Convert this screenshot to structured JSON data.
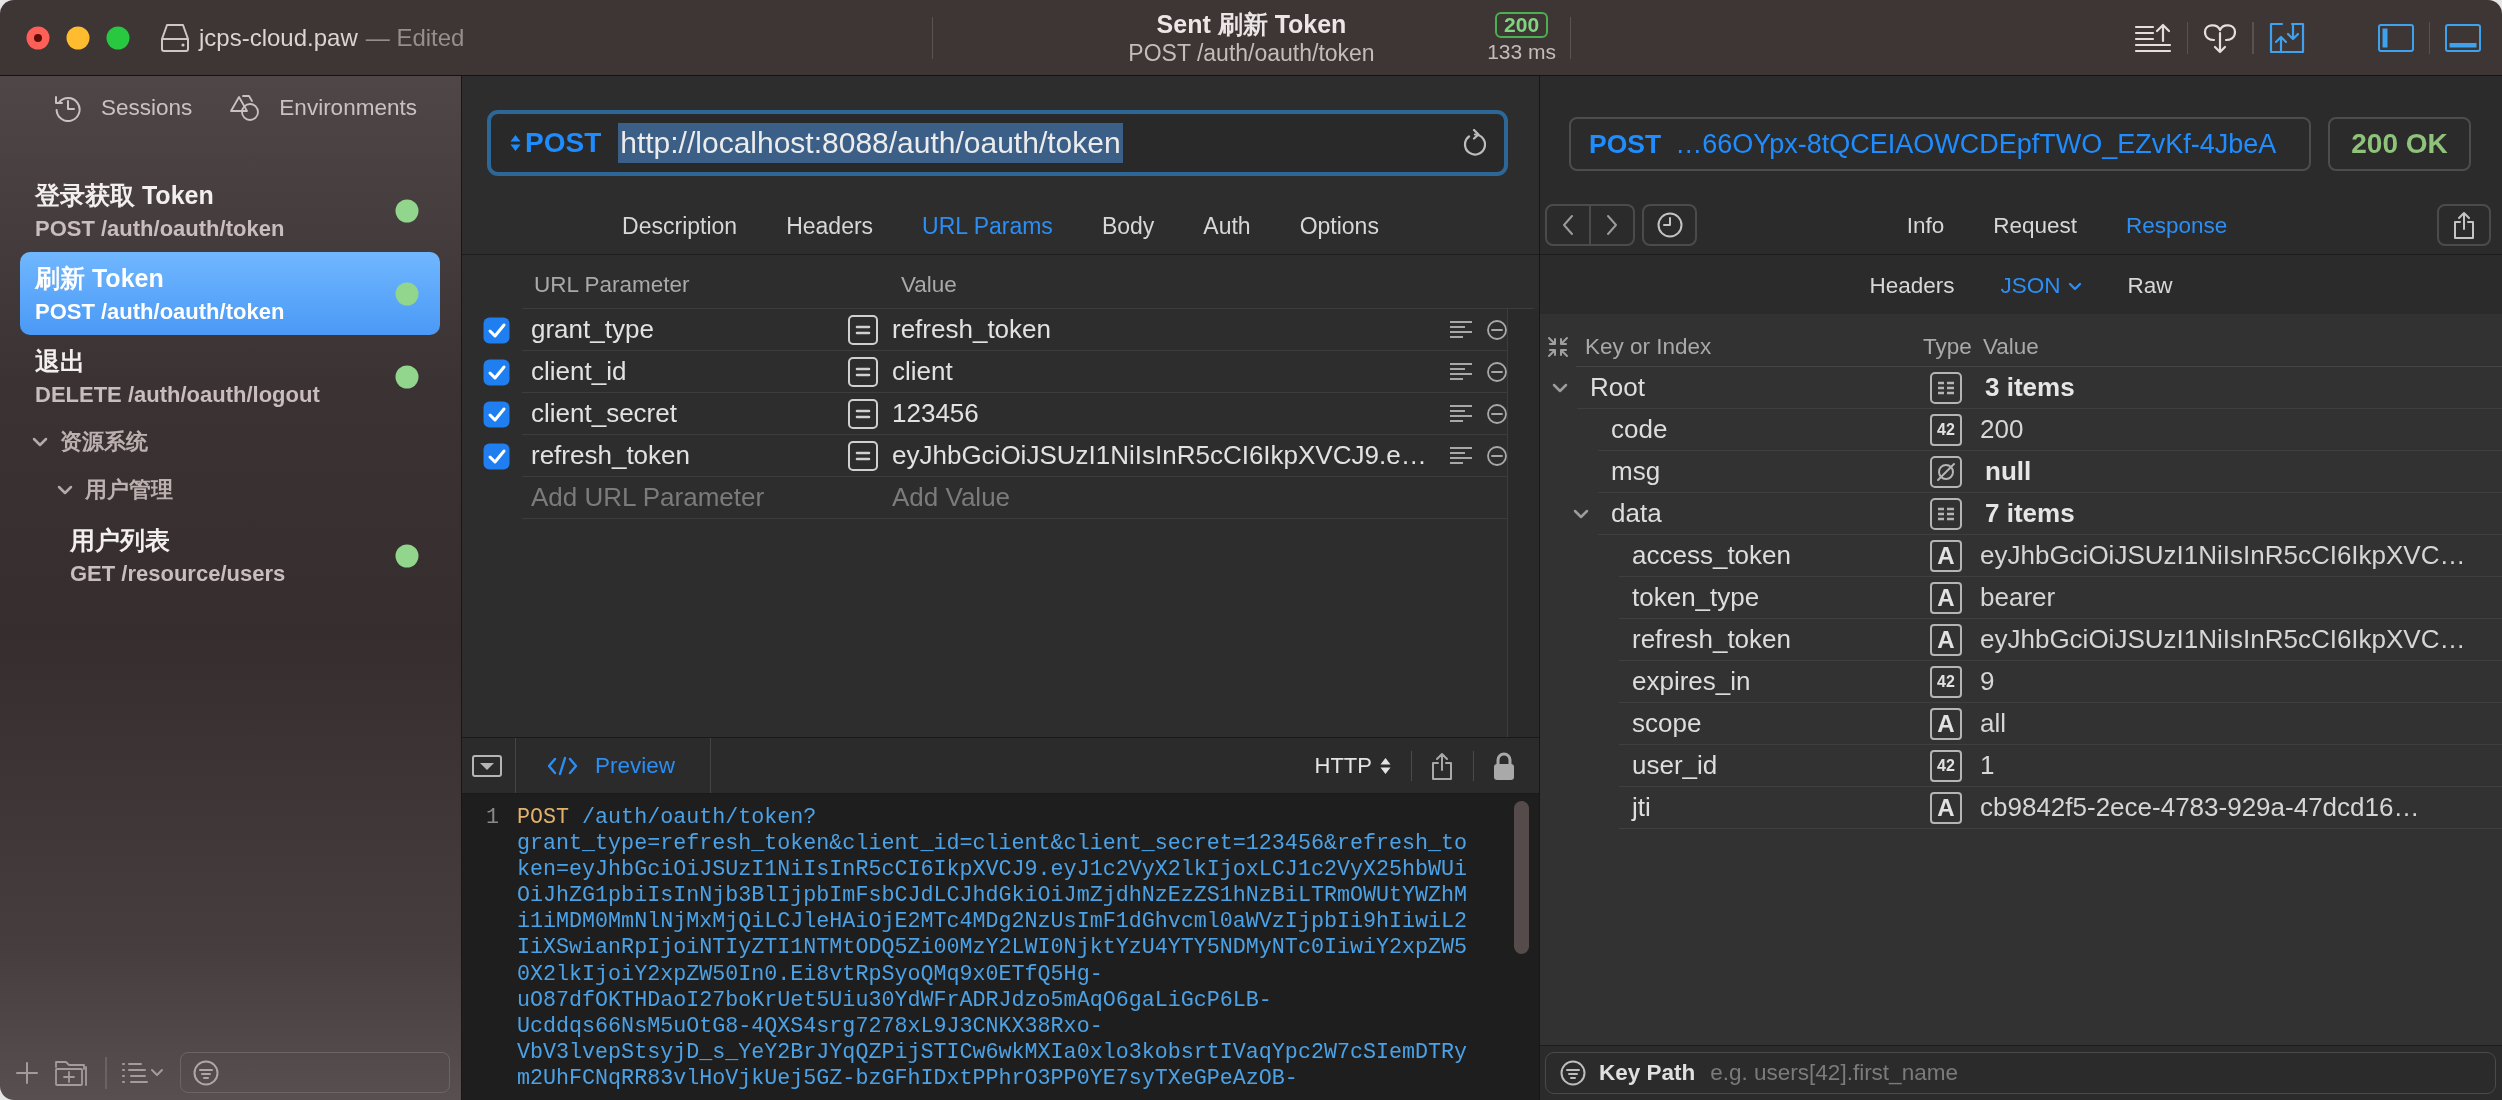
{
  "window": {
    "title": "jcps-cloud.paw",
    "edited_label": "— Edited"
  },
  "toolbar_status": {
    "title": "Sent 刷新 Token",
    "subtitle": "POST /auth/oauth/token",
    "status_code": "200",
    "duration": "133 ms"
  },
  "sidebar": {
    "tabs": [
      {
        "label": "Sessions",
        "kind": "sessions"
      },
      {
        "label": "Environments",
        "kind": "environments"
      }
    ],
    "items": [
      {
        "kind": "request",
        "title": "登录获取 Token",
        "subtitle": "POST /auth/oauth/token",
        "selected": false
      },
      {
        "kind": "request",
        "title": "刷新 Token",
        "subtitle": "POST /auth/oauth/token",
        "selected": true
      },
      {
        "kind": "request",
        "title": "退出",
        "subtitle": "DELETE /auth/oauth/logout",
        "selected": false
      },
      {
        "kind": "group",
        "title": "资源系统",
        "expanded": true,
        "children": [
          {
            "kind": "group",
            "title": "用户管理",
            "expanded": true,
            "children": [
              {
                "kind": "request",
                "title": "用户列表",
                "subtitle": "GET /resource/users",
                "selected": false
              }
            ]
          }
        ]
      }
    ]
  },
  "request": {
    "method": "POST",
    "url": "http://localhost:8088/auth/oauth/token",
    "url_text_selected": true,
    "tabs": [
      {
        "label": "Description",
        "selected": false
      },
      {
        "label": "Headers",
        "selected": false
      },
      {
        "label": "URL Params",
        "selected": true
      },
      {
        "label": "Body",
        "selected": false
      },
      {
        "label": "Auth",
        "selected": false
      },
      {
        "label": "Options",
        "selected": false
      }
    ],
    "params": {
      "columns": [
        "URL Parameter",
        "Value"
      ],
      "rows": [
        {
          "name": "grant_type",
          "value": "refresh_token",
          "enabled": true
        },
        {
          "name": "client_id",
          "value": "client",
          "enabled": true
        },
        {
          "name": "client_secret",
          "value": "123456",
          "enabled": true
        },
        {
          "name": "refresh_token",
          "value": "eyJhbGciOiJSUzI1NiIsInR5cCI6IkpXVCJ9.e…",
          "enabled": true
        }
      ],
      "new_row": {
        "name_placeholder": "Add URL Parameter",
        "value_placeholder": "Add Value"
      }
    }
  },
  "preview": {
    "tab": "Preview",
    "format": "HTTP",
    "line_number": "1",
    "method": "POST",
    "lines": [
      "/auth/oauth/token?",
      "grant_type=refresh_token&client_id=client&client_secret=123456&refresh_to",
      "ken=eyJhbGciOiJSUzI1NiIsInR5cCI6IkpXVCJ9.eyJ1c2VyX2lkIjoxLCJ1c2VyX25hbWUi",
      "OiJhZG1pbiIsInNjb3BlIjpbImFsbCJdLCJhdGkiOiJmZjdhNzEzZS1hNzBiLTRmOWUtYWZhM",
      "i1iMDM0MmNlNjMxMjQiLCJleHAiOjE2MTc4MDg2NzUsImF1dGhvcml0aWVzIjpbIi9hIiwiL2",
      "IiXSwianRpIjoiNTIyZTI1NTMtODQ5Zi00MzY2LWI0NjktYzU4YTY5NDMyNTc0IiwiY2xpZW5",
      "0X2lkIjoiY2xpZW50In0.Ei8vtRpSyoQMq9x0ETfQ5Hg-",
      "uO87dfOKTHDaoI27boKrUet5Uiu30YdWFrADRJdzo5mAqO6gaLiGcP6LB-",
      "Ucddqs66NsM5uOtG8-4QXS4srg7278xL9J3CNKX38Rxo-",
      "VbV3lvepStsyjD_s_YeY2BrJYqQZPijSTICw6wkMXIa0xlo3kobsrtIVaqYpc2W7cSIemDTRy",
      "m2UhFCNqRR83vlHoVjkUej5GZ-bzGFhIDxtPPhrO3PP0YE7syTXeGPeAzOB-"
    ]
  },
  "response": {
    "method": "POST",
    "url": "…66OYpx-8tQCEIAOWCDEpfTWO_EZvKf-4JbeA",
    "status": "200 OK",
    "tabs": [
      {
        "label": "Info",
        "selected": false
      },
      {
        "label": "Request",
        "selected": false
      },
      {
        "label": "Response",
        "selected": true
      }
    ],
    "body_tabs": [
      {
        "label": "Headers",
        "selected": false,
        "dropdown": false
      },
      {
        "label": "JSON",
        "selected": true,
        "dropdown": true
      },
      {
        "label": "Raw",
        "selected": false,
        "dropdown": false
      }
    ],
    "json_tree": {
      "columns": [
        "Key or Index",
        "Type",
        "Value"
      ],
      "nodes": [
        {
          "key": "Root",
          "kind": "object",
          "value": "3 items",
          "expanded": true,
          "children": [
            {
              "key": "code",
              "kind": "number",
              "type_label": "42",
              "value": "200"
            },
            {
              "key": "msg",
              "kind": "null",
              "value": "null"
            },
            {
              "key": "data",
              "kind": "object",
              "value": "7 items",
              "expanded": true,
              "children": [
                {
                  "key": "access_token",
                  "kind": "string",
                  "type_label": "A",
                  "value": "eyJhbGciOiJSUzI1NiIsInR5cCI6IkpXVC…"
                },
                {
                  "key": "token_type",
                  "kind": "string",
                  "type_label": "A",
                  "value": "bearer"
                },
                {
                  "key": "refresh_token",
                  "kind": "string",
                  "type_label": "A",
                  "value": "eyJhbGciOiJSUzI1NiIsInR5cCI6IkpXVC…"
                },
                {
                  "key": "expires_in",
                  "kind": "number",
                  "type_label": "42",
                  "value": "9"
                },
                {
                  "key": "scope",
                  "kind": "string",
                  "type_label": "A",
                  "value": "all"
                },
                {
                  "key": "user_id",
                  "kind": "number",
                  "type_label": "42",
                  "value": "1"
                },
                {
                  "key": "jti",
                  "kind": "string",
                  "type_label": "A",
                  "value": "cb9842f5-2ece-4783-929a-47dcd16…"
                }
              ]
            }
          ]
        }
      ]
    },
    "key_path": {
      "label": "Key Path",
      "placeholder": "e.g. users[42].first_name"
    }
  }
}
